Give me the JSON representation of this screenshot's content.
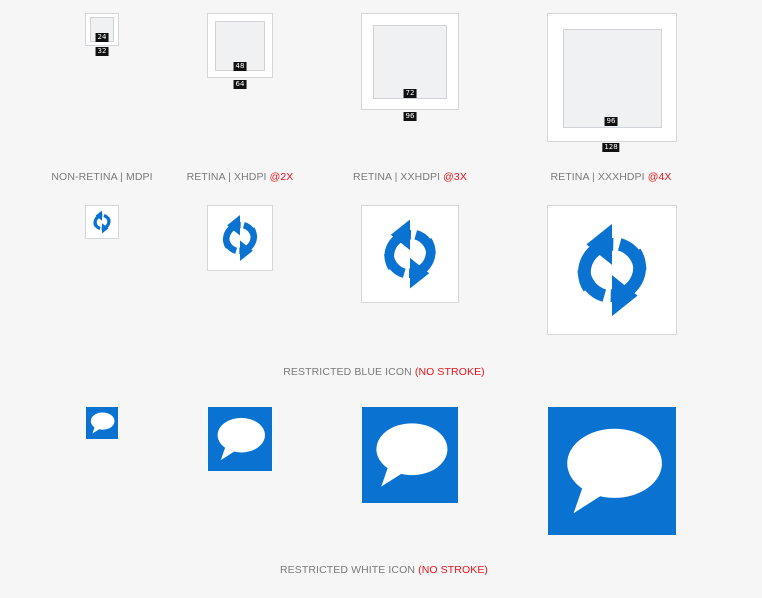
{
  "size_grid": {
    "items": [
      {
        "inner_label": "24",
        "outer_label": "32"
      },
      {
        "inner_label": "48",
        "outer_label": "64"
      },
      {
        "inner_label": "72",
        "outer_label": "96"
      },
      {
        "inner_label": "96",
        "outer_label": "128"
      }
    ]
  },
  "density_labels": [
    {
      "main": "NON-RETINA | MDPI",
      "accent": ""
    },
    {
      "main": "RETINA | XHDPI ",
      "accent": "@2X"
    },
    {
      "main": "RETINA | XXHDPI ",
      "accent": "@3X"
    },
    {
      "main": "RETINA | XXXHDPI ",
      "accent": "@4X"
    }
  ],
  "sections": {
    "blue_icon": {
      "main": "RESTRICTED BLUE ICON ",
      "accent": "(NO STROKE)"
    },
    "white_icon": {
      "main": "RESTRICTED WHITE ICON ",
      "accent": "(NO STROKE)"
    }
  },
  "icons": {
    "row1": "refresh-icon",
    "row2": "chat-bubble-icon"
  },
  "colors": {
    "icon_blue": "#0a72d1",
    "accent_red": "#e8141b",
    "label_gray": "#7a7a7a"
  }
}
